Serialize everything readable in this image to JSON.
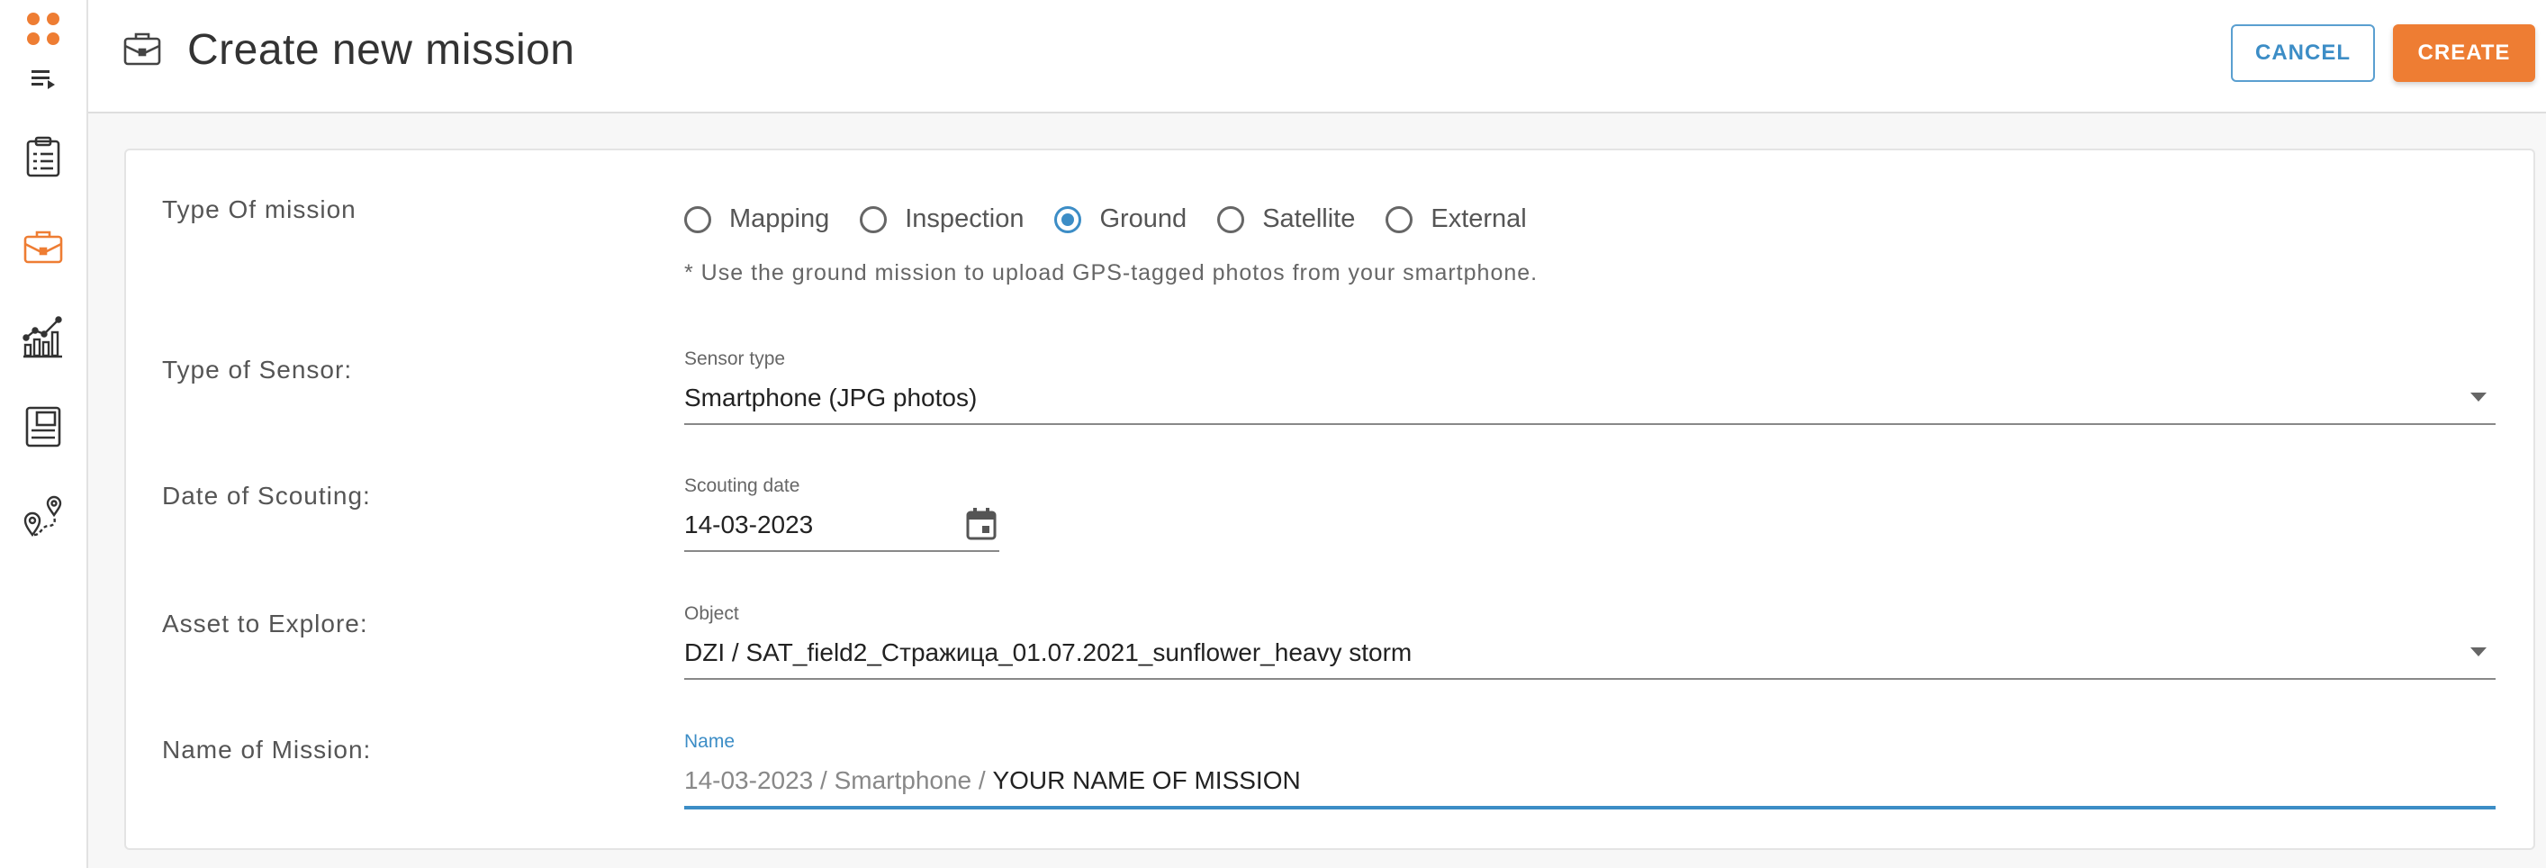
{
  "header": {
    "title": "Create new mission",
    "cancel_label": "CANCEL",
    "create_label": "CREATE"
  },
  "sidebar": {
    "items": [
      {
        "icon": "apps-grid-icon"
      },
      {
        "icon": "menu-list-icon"
      },
      {
        "icon": "clipboard-icon"
      },
      {
        "icon": "briefcase-icon",
        "active": true
      },
      {
        "icon": "analytics-chart-icon"
      },
      {
        "icon": "storage-icon"
      },
      {
        "icon": "route-map-icon"
      }
    ]
  },
  "form": {
    "mission_type": {
      "label": "Type Of mission",
      "options": [
        "Mapping",
        "Inspection",
        "Ground",
        "Satellite",
        "External"
      ],
      "selected": "Ground",
      "hint": "* Use the ground mission to upload GPS-tagged photos from your smartphone."
    },
    "sensor": {
      "label": "Type of Sensor:",
      "field_label": "Sensor type",
      "value": "Smartphone (JPG photos)"
    },
    "date": {
      "label": "Date of Scouting:",
      "field_label": "Scouting date",
      "value": "14-03-2023"
    },
    "asset": {
      "label": "Asset to Explore:",
      "field_label": "Object",
      "value": "DZI / SAT_field2_Стражица_01.07.2021_sunflower_heavy storm"
    },
    "name": {
      "label": "Name of Mission:",
      "field_label": "Name",
      "prefix": "14-03-2023 / Smartphone / ",
      "value": "YOUR NAME OF MISSION"
    }
  },
  "colors": {
    "accent": "#ee7d33",
    "primary": "#3c8dc6",
    "background": "#f7f7f7"
  }
}
